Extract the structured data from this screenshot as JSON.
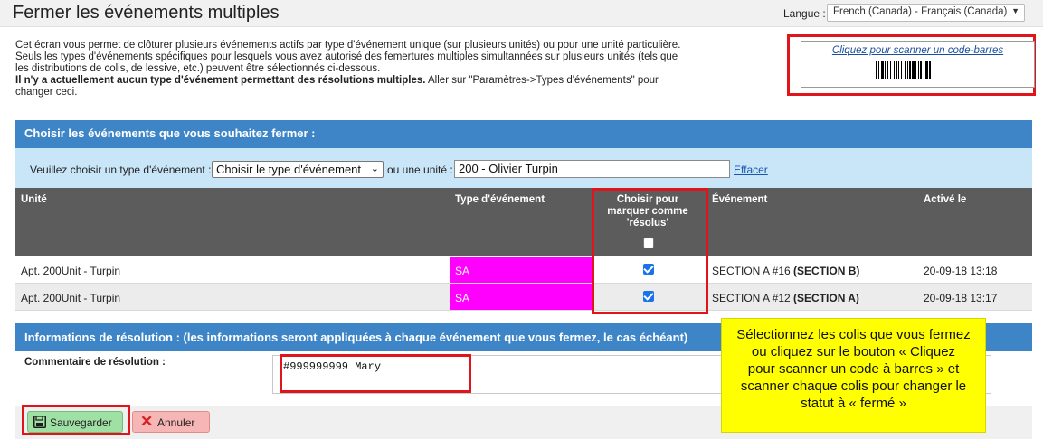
{
  "header": {
    "title": "Fermer les événements multiples",
    "language_label": "Langue :",
    "language_value": "French (Canada) - Français (Canada)"
  },
  "intro": {
    "line1": "Cet écran vous permet de clôturer plusieurs événements actifs par type d'événement unique (sur plusieurs unités) ou pour une unité particulière.",
    "line2": "Seuls les types d'événements spécifiques pour lesquels vous avez autorisé des femertures multiples simultannées sur plusieurs unités (tels que les distributions de colis, de lessive, etc.) peuvent être sélectionnés ci-dessous.",
    "line3_bold": "Il n'y a actuellement aucun type d'événement permettant des résolutions multiples.",
    "line3_rest": " Aller sur \"Paramètres->Types d'événements\" pour changer ceci."
  },
  "scanner": {
    "link_label": "Cliquez pour scanner un code-barres",
    "barcode_icon": "barcode-icon"
  },
  "choose_panel": {
    "title": "Choisir les événements que vous souhaitez fermer :",
    "type_label": "Veuillez choisir un type d'événement :",
    "type_select_value": "Choisir le type d'événement",
    "unit_label": "ou une unité :",
    "unit_value": "200 - Olivier Turpin",
    "clear_label": "Effacer"
  },
  "table": {
    "columns": {
      "unit": "Unité",
      "event_type": "Type d'événement",
      "select": "Choisir pour marquer comme 'résolus'",
      "event": "Événement",
      "activated": "Activé le"
    },
    "rows": [
      {
        "unit": "Apt. 200Unit - Turpin",
        "event_type": "SA",
        "checked": true,
        "event_prefix": "SECTION A #16 ",
        "event_bold": "(SECTION B)",
        "activated": "20-09-18 13:18"
      },
      {
        "unit": "Apt. 200Unit - Turpin",
        "event_type": "SA",
        "checked": true,
        "event_prefix": "SECTION A #12 ",
        "event_bold": "(SECTION A)",
        "activated": "20-09-18 13:17"
      }
    ]
  },
  "resolution_panel": {
    "title": "Informations de résolution : (les informations seront appliquées à chaque événement que vous fermez, le cas échéant)",
    "comment_label": "Commentaire de résolution :",
    "comment_value": "#999999999 Mary"
  },
  "buttons": {
    "save": "Sauvegarder",
    "cancel": "Annuler"
  },
  "callout": {
    "text": "Sélectionnez les colis que vous fermez ou cliquez sur le bouton « Cliquez pour scanner un code à barres » et scanner chaque colis pour changer le statut à « fermé »"
  },
  "colors": {
    "panel_header": "#3d85c6",
    "filter_bar": "#c9e6f8",
    "table_header": "#5c5c5c",
    "event_type_badge": "#ff00ff",
    "highlight_outline": "#e0141b",
    "callout_background": "#ffff00",
    "save_button": "#9fe0a4",
    "cancel_button": "#f7b6b6"
  }
}
